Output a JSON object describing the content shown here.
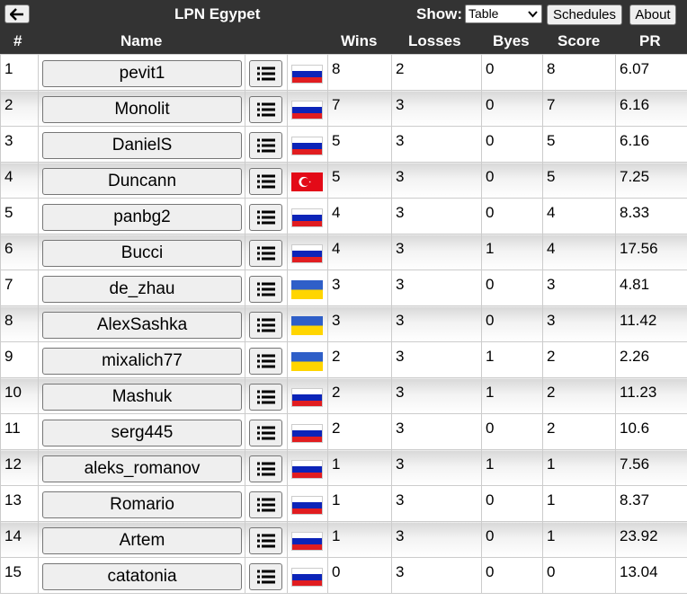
{
  "header": {
    "back_icon": "arrow-left-icon",
    "title": "LPN Egypet",
    "show_label": "Show:",
    "show_value": "Table",
    "schedules_label": "Schedules",
    "about_label": "About"
  },
  "columns": {
    "rank": "#",
    "name": "Name",
    "wins": "Wins",
    "losses": "Losses",
    "byes": "Byes",
    "score": "Score",
    "pr": "PR"
  },
  "rows": [
    {
      "rank": "1",
      "name": "pevit1",
      "flag": "ru",
      "wins": "8",
      "losses": "2",
      "byes": "0",
      "score": "8",
      "pr": "6.07"
    },
    {
      "rank": "2",
      "name": "Monolit",
      "flag": "ru",
      "wins": "7",
      "losses": "3",
      "byes": "0",
      "score": "7",
      "pr": "6.16"
    },
    {
      "rank": "3",
      "name": "DanielS",
      "flag": "ru",
      "wins": "5",
      "losses": "3",
      "byes": "0",
      "score": "5",
      "pr": "6.16"
    },
    {
      "rank": "4",
      "name": "Duncann",
      "flag": "tr",
      "wins": "5",
      "losses": "3",
      "byes": "0",
      "score": "5",
      "pr": "7.25"
    },
    {
      "rank": "5",
      "name": "panbg2",
      "flag": "ru",
      "wins": "4",
      "losses": "3",
      "byes": "0",
      "score": "4",
      "pr": "8.33"
    },
    {
      "rank": "6",
      "name": "Bucci",
      "flag": "ru",
      "wins": "4",
      "losses": "3",
      "byes": "1",
      "score": "4",
      "pr": "17.56"
    },
    {
      "rank": "7",
      "name": "de_zhau",
      "flag": "ua",
      "wins": "3",
      "losses": "3",
      "byes": "0",
      "score": "3",
      "pr": "4.81"
    },
    {
      "rank": "8",
      "name": "AlexSashka",
      "flag": "ua",
      "wins": "3",
      "losses": "3",
      "byes": "0",
      "score": "3",
      "pr": "11.42"
    },
    {
      "rank": "9",
      "name": "mixalich77",
      "flag": "ua",
      "wins": "2",
      "losses": "3",
      "byes": "1",
      "score": "2",
      "pr": "2.26"
    },
    {
      "rank": "10",
      "name": "Mashuk",
      "flag": "ru",
      "wins": "2",
      "losses": "3",
      "byes": "1",
      "score": "2",
      "pr": "11.23"
    },
    {
      "rank": "11",
      "name": "serg445",
      "flag": "ru",
      "wins": "2",
      "losses": "3",
      "byes": "0",
      "score": "2",
      "pr": "10.6"
    },
    {
      "rank": "12",
      "name": "aleks_romanov",
      "flag": "ru",
      "wins": "1",
      "losses": "3",
      "byes": "1",
      "score": "1",
      "pr": "7.56"
    },
    {
      "rank": "13",
      "name": "Romario",
      "flag": "ru",
      "wins": "1",
      "losses": "3",
      "byes": "0",
      "score": "1",
      "pr": "8.37"
    },
    {
      "rank": "14",
      "name": "Artem",
      "flag": "ru",
      "wins": "1",
      "losses": "3",
      "byes": "0",
      "score": "1",
      "pr": "23.92"
    },
    {
      "rank": "15",
      "name": "catatonia",
      "flag": "ru",
      "wins": "0",
      "losses": "3",
      "byes": "0",
      "score": "0",
      "pr": "13.04"
    }
  ],
  "colors": {
    "header_bg": "#333333",
    "header_text": "#ffffff",
    "ru_white": "#ffffff",
    "ru_blue": "#0c24b8",
    "ru_red": "#e11d20",
    "ua_blue": "#2f5fc8",
    "ua_yellow": "#ffd500",
    "tr_red": "#e30a17"
  }
}
